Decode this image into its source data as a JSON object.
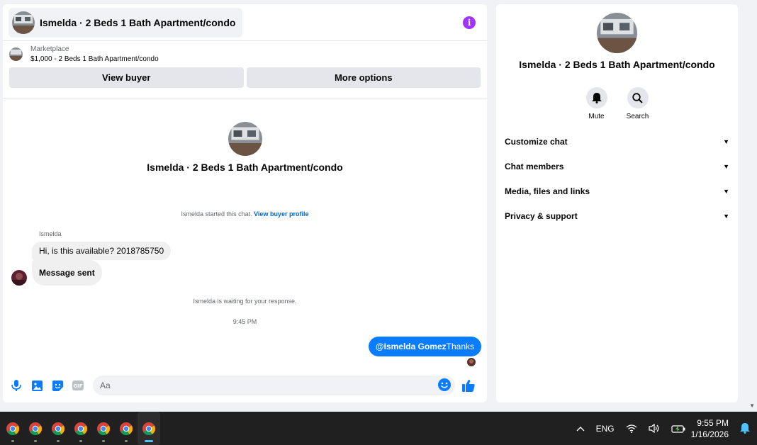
{
  "chat": {
    "title": "Ismelda · 2 Beds 1 Bath Apartment/condo",
    "listing": {
      "source": "Marketplace",
      "summary": "$1,000 - 2 Beds 1 Bath Apartment/condo",
      "view_buyer_label": "View buyer",
      "more_options_label": "More options"
    },
    "intro_name": "Ismelda · 2 Beds 1 Bath Apartment/condo",
    "started_text": "Ismelda started this chat.",
    "view_profile_link": "View buyer profile",
    "sender_name": "Ismelda",
    "messages_in": [
      "Hi, is this available? 2018785750",
      "Message sent"
    ],
    "waiting_text": "Ismelda is waiting for your response.",
    "timestamp": "9:45 PM",
    "message_out": {
      "mention": "@Ismelda Gomez",
      "text": "Thanks"
    },
    "composer": {
      "placeholder": "Aa"
    }
  },
  "info": {
    "name": "Ismelda · 2 Beds 1 Bath Apartment/condo",
    "mute_label": "Mute",
    "search_label": "Search",
    "sections": [
      "Customize chat",
      "Chat members",
      "Media, files and links",
      "Privacy & support"
    ]
  },
  "taskbar": {
    "language": "ENG",
    "time": "9:55 PM",
    "date": "1/16/2026"
  },
  "colors": {
    "accent": "#0a7cff",
    "link": "#0064d1",
    "info_icon": "#a033ff"
  }
}
